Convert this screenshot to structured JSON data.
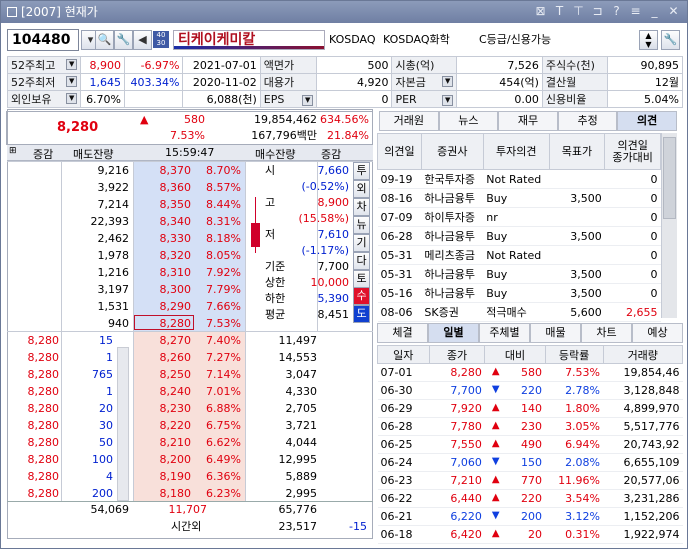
{
  "window": {
    "title": "[2007] 현재가"
  },
  "toolbar": {
    "code": "104480",
    "mark": "40 30",
    "name": "티케이케미칼",
    "market": "KOSDAQ",
    "sector": "KOSDAQ화학",
    "grade": "C등급/신용가능"
  },
  "info": [
    [
      "52주최고",
      "8,900",
      "-6.97%",
      "2021-07-01",
      "액면가",
      "500",
      "시총(억)",
      "7,526",
      "주식수(천)",
      "90,895"
    ],
    [
      "52주최저",
      "1,645",
      "403.34%",
      "2020-11-02",
      "대용가",
      "4,920",
      "자본금",
      "454(억)",
      "결산월",
      "12월"
    ],
    [
      "외인보유",
      "6.70%",
      "",
      "6,088(천)",
      "EPS",
      "0",
      "PER",
      "0.00",
      "신용비율",
      "5.04%"
    ]
  ],
  "summary": {
    "price": "8,280",
    "change": "580",
    "rate": "7.53%",
    "volume": "19,854,462",
    "vol_amt": "167,796백만",
    "vr1": "634.56%",
    "vr2": "21.84%"
  },
  "orderbook": {
    "headers": {
      "incdec": "증감",
      "ask": "매도잔량",
      "time": "15:59:47",
      "bid": "매수잔량",
      "incdec2": "증감"
    },
    "asks": [
      {
        "qty": "9,216",
        "price": "8,370",
        "rate": "8.70%"
      },
      {
        "qty": "3,922",
        "price": "8,360",
        "rate": "8.57%"
      },
      {
        "qty": "7,214",
        "price": "8,350",
        "rate": "8.44%"
      },
      {
        "qty": "22,393",
        "price": "8,340",
        "rate": "8.31%"
      },
      {
        "qty": "2,462",
        "price": "8,330",
        "rate": "8.18%"
      },
      {
        "qty": "1,978",
        "price": "8,320",
        "rate": "8.05%"
      },
      {
        "qty": "1,216",
        "price": "8,310",
        "rate": "7.92%"
      },
      {
        "qty": "3,197",
        "price": "8,300",
        "rate": "7.79%"
      },
      {
        "qty": "1,531",
        "price": "8,290",
        "rate": "7.66%"
      },
      {
        "qty": "940",
        "price": "8,280",
        "rate": "7.53%"
      }
    ],
    "bids": [
      {
        "tp": "8,280",
        "tq": "15",
        "price": "8,270",
        "rate": "7.40%",
        "qty": "11,497"
      },
      {
        "tp": "8,280",
        "tq": "1",
        "price": "8,260",
        "rate": "7.27%",
        "qty": "14,553"
      },
      {
        "tp": "8,280",
        "tq": "765",
        "price": "8,250",
        "rate": "7.14%",
        "qty": "3,047"
      },
      {
        "tp": "8,280",
        "tq": "1",
        "price": "8,240",
        "rate": "7.01%",
        "qty": "4,330"
      },
      {
        "tp": "8,280",
        "tq": "20",
        "price": "8,230",
        "rate": "6.88%",
        "qty": "2,705"
      },
      {
        "tp": "8,280",
        "tq": "30",
        "price": "8,220",
        "rate": "6.75%",
        "qty": "3,721"
      },
      {
        "tp": "8,280",
        "tq": "50",
        "price": "8,210",
        "rate": "6.62%",
        "qty": "4,044"
      },
      {
        "tp": "8,280",
        "tq": "100",
        "price": "8,200",
        "rate": "6.49%",
        "qty": "12,995"
      },
      {
        "tp": "8,280",
        "tq": "4",
        "price": "8,190",
        "rate": "6.36%",
        "qty": "5,889"
      },
      {
        "tp": "8,280",
        "tq": "200",
        "price": "8,180",
        "rate": "6.23%",
        "qty": "2,995"
      }
    ],
    "prices": [
      {
        "l": "시",
        "v": "7,660"
      },
      {
        "l": "",
        "v": "(-0.52%)"
      },
      {
        "l": "고",
        "v": "8,900"
      },
      {
        "l": "",
        "v": "(15.58%)"
      },
      {
        "l": "저",
        "v": "7,610"
      },
      {
        "l": "",
        "v": "(-1.17%)"
      },
      {
        "l": "기준",
        "v": "7,700"
      },
      {
        "l": "상한",
        "v": "10,000"
      },
      {
        "l": "하한",
        "v": "5,390"
      },
      {
        "l": "평균",
        "v": "8,451"
      }
    ],
    "side": [
      "투",
      "외",
      "차",
      "뉴",
      "기",
      "다",
      "토",
      "수",
      "도"
    ],
    "total": {
      "ask": "54,069",
      "mid": "11,707",
      "bid": "65,776"
    },
    "after": {
      "label": "시간외",
      "bid": "23,517",
      "diff": "-15"
    }
  },
  "rtabs": [
    "거래원",
    "뉴스",
    "재무",
    "추정",
    "의견"
  ],
  "brokers": {
    "headers": [
      "의견일",
      "증권사",
      "투자의견",
      "목표가",
      "의견일\n종가대비"
    ],
    "rows": [
      [
        "09-19",
        "한국투자증",
        "Not Rated",
        "",
        "0"
      ],
      [
        "08-16",
        "하나금융투",
        "Buy",
        "3,500",
        "0"
      ],
      [
        "07-09",
        "하이투자증",
        "nr",
        "",
        "0"
      ],
      [
        "06-28",
        "하나금융투",
        "Buy",
        "3,500",
        "0"
      ],
      [
        "05-31",
        "메리츠종금",
        "Not Rated",
        "",
        "0"
      ],
      [
        "05-31",
        "하나금융투",
        "Buy",
        "3,500",
        "0"
      ],
      [
        "05-16",
        "하나금융투",
        "Buy",
        "3,500",
        "0"
      ],
      [
        "08-06",
        "SK증권",
        "적극매수",
        "5,600",
        "2,655"
      ]
    ]
  },
  "dtabs": [
    "체결",
    "일별",
    "주체별",
    "매물",
    "차트",
    "예상"
  ],
  "daily": {
    "headers": [
      "일자",
      "종가",
      "대비",
      "등락률",
      "거래량"
    ],
    "rows": [
      [
        "07-01",
        "8,280",
        "up",
        "580",
        "7.53%",
        "19,854,46"
      ],
      [
        "06-30",
        "7,700",
        "down",
        "220",
        "2.78%",
        "3,128,848"
      ],
      [
        "06-29",
        "7,920",
        "up",
        "140",
        "1.80%",
        "4,899,970"
      ],
      [
        "06-28",
        "7,780",
        "up",
        "230",
        "3.05%",
        "5,517,776"
      ],
      [
        "06-25",
        "7,550",
        "up",
        "490",
        "6.94%",
        "20,743,92"
      ],
      [
        "06-24",
        "7,060",
        "down",
        "150",
        "2.08%",
        "6,655,109"
      ],
      [
        "06-23",
        "7,210",
        "up",
        "770",
        "11.96%",
        "20,577,06"
      ],
      [
        "06-22",
        "6,440",
        "up",
        "220",
        "3.54%",
        "3,231,286"
      ],
      [
        "06-21",
        "6,220",
        "down",
        "200",
        "3.12%",
        "1,152,206"
      ],
      [
        "06-18",
        "6,420",
        "up",
        "20",
        "0.31%",
        "1,922,974"
      ]
    ]
  }
}
